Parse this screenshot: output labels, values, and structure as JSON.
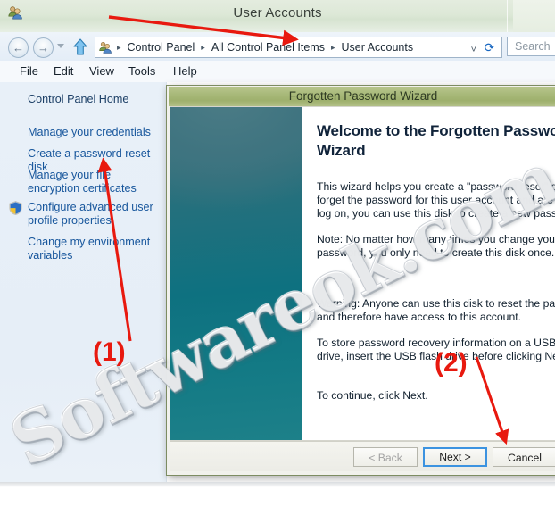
{
  "window": {
    "title": "User Accounts",
    "icon": "user-accounts-icon"
  },
  "nav": {
    "back_icon": "back-arrow-icon",
    "forward_icon": "forward-arrow-icon",
    "history_icon": "chevron-down-icon",
    "up_icon": "up-arrow-icon",
    "refresh_icon": "refresh-icon",
    "address_icon": "user-accounts-icon",
    "address_dropdown_icon": "chevron-down-icon",
    "breadcrumbs": [
      "Control Panel",
      "All Control Panel Items",
      "User Accounts"
    ],
    "separator": "▸"
  },
  "search": {
    "placeholder": "Search",
    "value": ""
  },
  "menu": {
    "items": [
      "File",
      "Edit",
      "View",
      "Tools",
      "Help"
    ]
  },
  "sidebar": {
    "items": [
      {
        "label": "Control Panel Home",
        "shield": false
      },
      {
        "label": "Manage your credentials",
        "shield": false
      },
      {
        "label": "Create a password reset disk",
        "shield": false
      },
      {
        "label": "Manage your file encryption certificates",
        "shield": false
      },
      {
        "label": "Configure advanced user profile properties",
        "shield": true
      },
      {
        "label": "Change my environment variables",
        "shield": false
      }
    ],
    "shield_icon": "uac-shield-icon"
  },
  "wizard": {
    "title": "Forgotten Password Wizard",
    "heading": "Welcome to the Forgotten Password Wizard",
    "paragraphs": [
      "This wizard helps you create a \"password reset\" disk.",
      "forget the password for this user account and are una",
      "log on, you can use this disk to create a new passwor",
      "Note: No matter how many times you change your",
      "password, you only need to create this disk once.",
      "Warning: Anyone can use this disk to reset the passw",
      "and therefore have access to this account.",
      "To store password recovery information on a USB flas",
      "drive, insert the USB flash drive before clicking Next.",
      "To continue, click Next."
    ],
    "buttons": {
      "back": "< Back",
      "next": "Next >",
      "cancel": "Cancel"
    }
  },
  "annotations": {
    "step_one": "(1)",
    "step_two": "(2)",
    "accent_color": "#e8190f"
  },
  "watermark": {
    "text": "Softwareok.com"
  },
  "colors": {
    "title_bar": "#dde8d7",
    "wizard_title_bar": "#a7b878",
    "wizard_side_panel": "#0e7180",
    "link": "#17569c",
    "focus_border": "#3c93e0"
  }
}
